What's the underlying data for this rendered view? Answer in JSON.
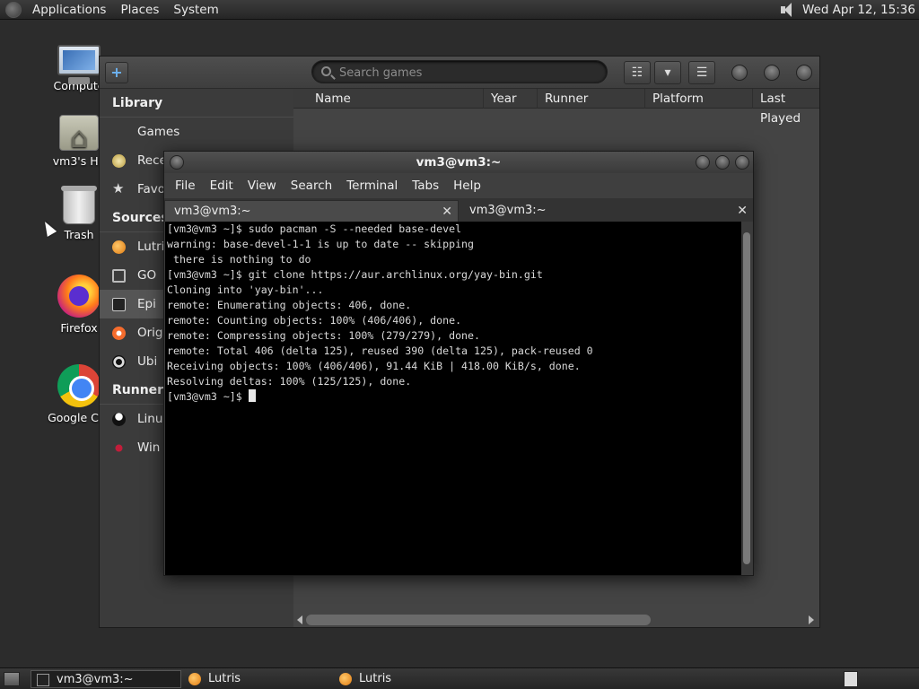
{
  "top_panel": {
    "menus": [
      "Applications",
      "Places",
      "System"
    ],
    "clock": "Wed Apr 12, 15:36"
  },
  "desktop": {
    "icons": [
      {
        "label": "Compute",
        "icon": "computer-icon"
      },
      {
        "label": "vm3's Ho",
        "icon": "home-folder-icon"
      },
      {
        "label": "Trash",
        "icon": "trash-icon"
      },
      {
        "label": "Firefox",
        "icon": "firefox-icon"
      },
      {
        "label": "Google Chr",
        "icon": "chrome-icon"
      }
    ]
  },
  "lutris": {
    "search_placeholder": "Search games",
    "add_symbol": "+",
    "view_symbol": "☷",
    "dropdown_symbol": "▾",
    "menu_symbol": "☰",
    "sidebar": {
      "library_title": "Library",
      "library_items": [
        "Games",
        "Rece",
        "Favo"
      ],
      "sources_title": "Sources",
      "source_items": [
        "Lutris",
        "GO",
        "Epi",
        "Orig",
        "Ubi"
      ],
      "runners_title": "Runners",
      "runner_items": [
        "Linu",
        "Win"
      ]
    },
    "columns": [
      "Name",
      "Year",
      "Runner",
      "Platform",
      "Last Played"
    ]
  },
  "terminal": {
    "title": "vm3@vm3:~",
    "menu": [
      "File",
      "Edit",
      "View",
      "Search",
      "Terminal",
      "Tabs",
      "Help"
    ],
    "tabs": [
      "vm3@vm3:~",
      "vm3@vm3:~"
    ],
    "close_symbol": "✕",
    "lines": [
      "[vm3@vm3 ~]$ sudo pacman -S --needed base-devel",
      "warning: base-devel-1-1 is up to date -- skipping",
      " there is nothing to do",
      "[vm3@vm3 ~]$ git clone https://aur.archlinux.org/yay-bin.git",
      "Cloning into 'yay-bin'...",
      "remote: Enumerating objects: 406, done.",
      "remote: Counting objects: 100% (406/406), done.",
      "remote: Compressing objects: 100% (279/279), done.",
      "remote: Total 406 (delta 125), reused 390 (delta 125), pack-reused 0",
      "Receiving objects: 100% (406/406), 91.44 KiB | 418.00 KiB/s, done.",
      "Resolving deltas: 100% (125/125), done."
    ],
    "prompt": "[vm3@vm3 ~]$ "
  },
  "taskbar": {
    "tasks": [
      "vm3@vm3:~",
      "Lutris",
      "Lutris"
    ]
  }
}
